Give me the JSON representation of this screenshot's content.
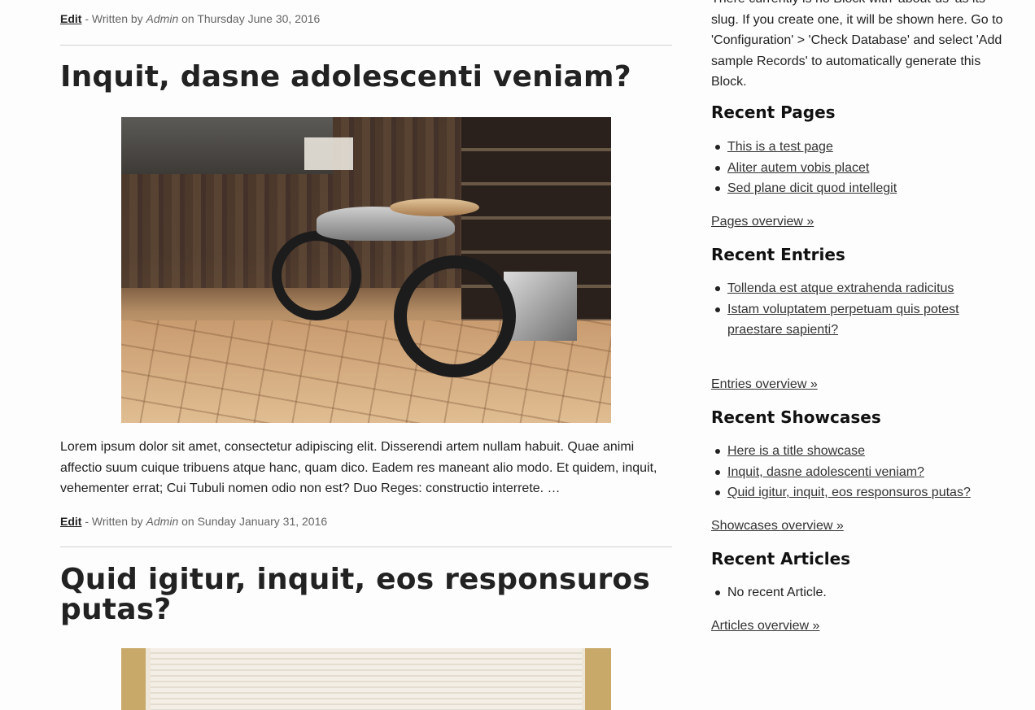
{
  "posts": [
    {
      "title": null,
      "meta": {
        "edit_label": "Edit",
        "written_by": "- Written by",
        "author": "Admin",
        "on": "on",
        "date": "Thursday June 30, 2016"
      }
    },
    {
      "title": "Inquit, dasne adolescenti veniam?",
      "image_icon": "garage-motorcycle-photo",
      "excerpt": "Lorem ipsum dolor sit amet, consectetur adipiscing elit. Disserendi artem nullam habuit. Quae animi affectio suum cuique tribuens atque hanc, quam dico. Eadem res maneant alio modo. Et quidem, inquit, vehementer errat; Cui Tubuli nomen odio non est? Duo Reges: constructio interrete. …",
      "meta": {
        "edit_label": "Edit",
        "written_by": "- Written by",
        "author": "Admin",
        "on": "on",
        "date": "Sunday January 31, 2016"
      }
    },
    {
      "title": "Quid igitur, inquit, eos responsuros putas?",
      "image_icon": "window-blinds-photo"
    }
  ],
  "sidebar": {
    "intro": "There currently is no Block with 'about-us' as its slug. If you create one, it will be shown here. Go to 'Configuration' > 'Check Database' and select 'Add sample Records' to automatically generate this Block.",
    "recent_pages": {
      "title": "Recent Pages",
      "items": [
        "This is a test page",
        "Aliter autem vobis placet",
        "Sed plane dicit quod intellegit"
      ],
      "overview": "Pages overview »"
    },
    "recent_entries": {
      "title": "Recent Entries",
      "items": [
        "",
        "Tollenda est atque extrahenda radicitus",
        "Istam voluptatem perpetuam quis potest praestare sapienti?"
      ],
      "overview": "Entries overview »"
    },
    "recent_showcases": {
      "title": "Recent Showcases",
      "items": [
        "Here is a title showcase",
        "Inquit, dasne adolescenti veniam?",
        "Quid igitur, inquit, eos responsuros putas?"
      ],
      "overview": "Showcases overview »"
    },
    "recent_articles": {
      "title": "Recent Articles",
      "items": [
        "No recent Article."
      ],
      "overview": "Articles overview »"
    }
  }
}
